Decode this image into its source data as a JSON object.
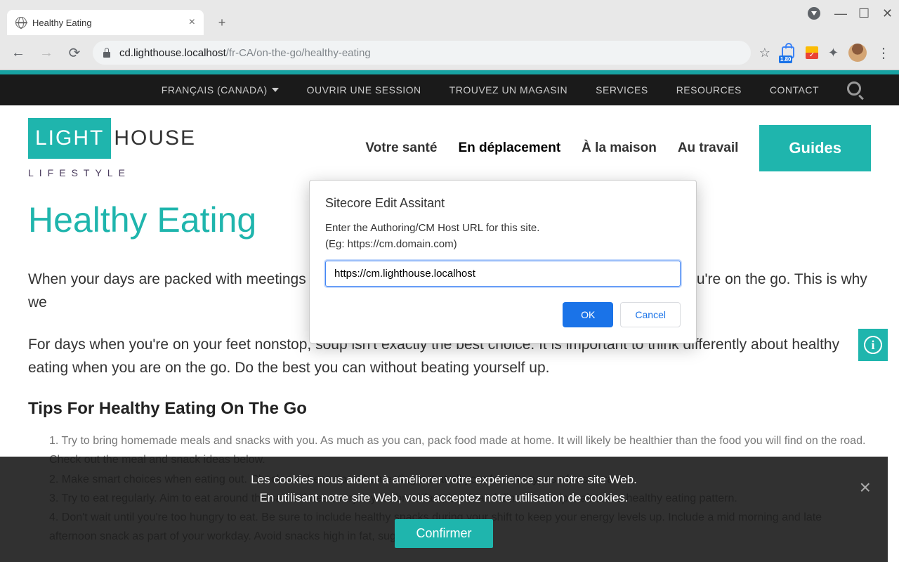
{
  "browser": {
    "tab_title": "Healthy Eating",
    "url_host": "cd.lighthouse.localhost",
    "url_path": "/fr-CA/on-the-go/healthy-eating",
    "ext_badge": "1.80"
  },
  "topnav": {
    "items": [
      "FRANÇAIS (CANADA)",
      "OUVRIR UNE SESSION",
      "TROUVEZ UN MAGASIN",
      "SERVICES",
      "RESOURCES",
      "CONTACT"
    ]
  },
  "logo": {
    "box": "LIGHT",
    "rest": "HOUSE",
    "sub": "LIFESTYLE"
  },
  "mainnav": {
    "items": [
      "Votre santé",
      "En déplacement",
      "À la maison",
      "Au travail"
    ],
    "active_index": 1,
    "guides": "Guides"
  },
  "page": {
    "title": "Healthy Eating",
    "para1": "When your days are packed with meetings and to-do's, you may find the only chance to eat is when you're on the go. This is why we",
    "para2": "For days when you're on your feet nonstop, soup isn't exactly the best choice. It is important to think differently about healthy eating when you are on the go. Do the best you can without beating yourself up.",
    "subhead": "Tips For Healthy Eating On The Go",
    "tips": [
      "1. Try to bring homemade meals and snacks with you. As much as you can, pack food made at home. It will likely be healthier than the food you will find on the road. Check out the meal and snack ideas below.",
      "2. Make smart choices when eating out. Check out these tips when eating out at all your favorite types of restaurants.",
      "3. Try to eat regularly. Aim to eat around the same times everyday for breakfast, lunch and dinner to help maintain a healthy eating pattern.",
      "4. Don't wait until you're too hungry to eat. Be sure to include healthy snacks during your shift to keep your energy levels up. Include a mid morning and late afternoon snack as part of your workday. Avoid snacks high in fat, sugar and salt."
    ]
  },
  "cookie": {
    "line1": "Les cookies nous aident à améliorer votre expérience sur notre site Web.",
    "line2": "En utilisant notre site Web, vous acceptez notre utilisation de cookies.",
    "confirm": "Confirmer"
  },
  "dialog": {
    "title": "Sitecore Edit Assitant",
    "desc_line1": "Enter the Authoring/CM Host URL for this site.",
    "desc_line2": "(Eg: https://cm.domain.com)",
    "input_value": "https://cm.lighthouse.localhost",
    "ok": "OK",
    "cancel": "Cancel"
  }
}
